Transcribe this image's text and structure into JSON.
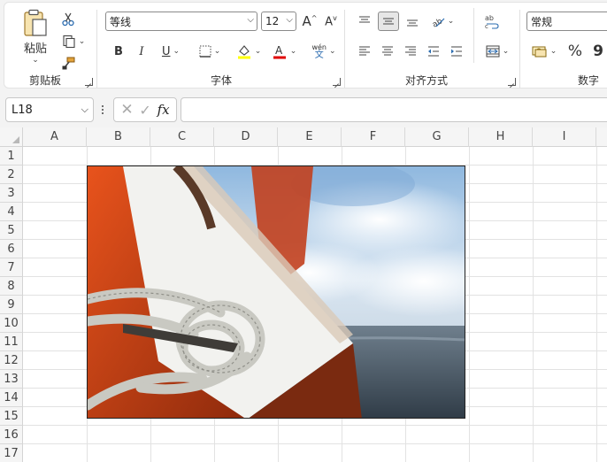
{
  "ribbon": {
    "clipboard": {
      "label": "剪贴板",
      "paste_label": "粘贴"
    },
    "font": {
      "label": "字体",
      "font_name": "等线",
      "font_size": "12",
      "bold": "B",
      "italic": "I",
      "underline": "U",
      "phonetic_top": "wén",
      "phonetic_bottom": "文"
    },
    "alignment": {
      "label": "对齐方式"
    },
    "number": {
      "label": "数字",
      "format": "常规",
      "percent": "%",
      "comma": "9"
    }
  },
  "formula_bar": {
    "cell_ref": "L18",
    "fx": "fx",
    "value": ""
  },
  "grid": {
    "columns": [
      "A",
      "B",
      "C",
      "D",
      "E",
      "F",
      "G",
      "H",
      "I"
    ],
    "rows": [
      "1",
      "2",
      "3",
      "4",
      "5",
      "6",
      "7",
      "8",
      "9",
      "10",
      "11",
      "12",
      "13",
      "14",
      "15",
      "16",
      "17"
    ]
  },
  "picture": {
    "description": "sailboat rope photo"
  }
}
